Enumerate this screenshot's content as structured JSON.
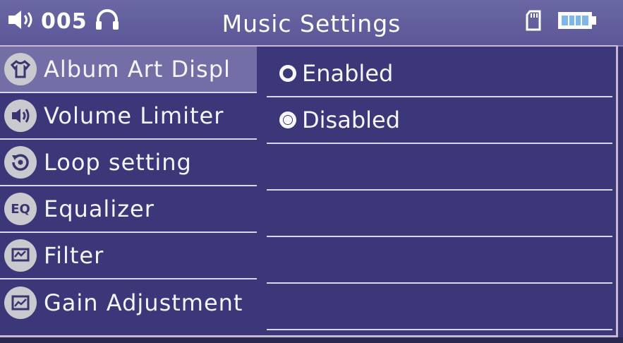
{
  "status": {
    "volume": "005",
    "title": "Music Settings",
    "icons": [
      "speaker-icon",
      "headphones-icon",
      "sd-card-icon",
      "battery-icon"
    ]
  },
  "menu": {
    "items": [
      {
        "label": "Album Art Displ",
        "icon": "shirt-icon",
        "selected": true
      },
      {
        "label": "Volume Limiter",
        "icon": "speaker-icon"
      },
      {
        "label": "Loop setting",
        "icon": "loop-icon"
      },
      {
        "label": "Equalizer",
        "icon": "eq-icon",
        "icon_text": "EQ"
      },
      {
        "label": "Filter",
        "icon": "filter-icon"
      },
      {
        "label": "Gain Adjustment",
        "icon": "gain-icon"
      }
    ]
  },
  "options": {
    "items": [
      {
        "label": "Enabled",
        "selected": false
      },
      {
        "label": "Disabled",
        "selected": true
      }
    ]
  },
  "colors": {
    "background": "#3b3778",
    "status_bar": "#5c5898",
    "selected_item": "#736fa6",
    "divider": "#d6d6e6",
    "icon_circle": "#c9c9cf"
  }
}
